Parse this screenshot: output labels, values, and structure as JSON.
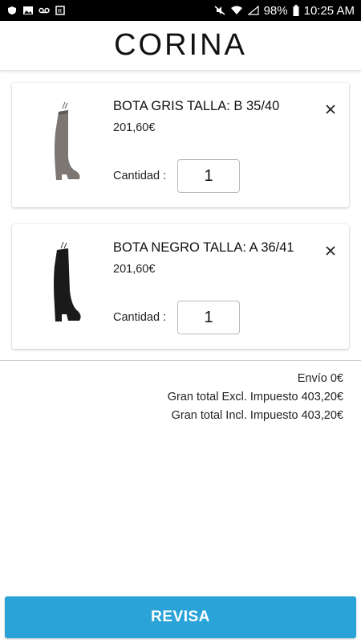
{
  "status_bar": {
    "battery": "98%",
    "time": "10:25 AM",
    "icons": [
      "shield-icon",
      "image-icon",
      "voicemail-icon",
      "data-icon",
      "mute-icon",
      "wifi-icon",
      "signal-icon",
      "battery-icon"
    ]
  },
  "header": {
    "brand": "CORINA"
  },
  "cart": {
    "items": [
      {
        "name": "BOTA GRIS TALLA: B 35/40",
        "price": "201,60€",
        "quantity_label": "Cantidad :",
        "quantity": "1",
        "image": "grey-boot",
        "color": "#7d7774"
      },
      {
        "name": "BOTA NEGRO TALLA: A 36/41",
        "price": "201,60€",
        "quantity_label": "Cantidad :",
        "quantity": "1",
        "image": "black-boot",
        "color": "#1a1a1a"
      }
    ]
  },
  "totals": {
    "shipping": "Envío 0€",
    "excl_tax": "Gran total Excl. Impuesto 403,20€",
    "incl_tax": "Gran total Incl. Impuesto 403,20€"
  },
  "actions": {
    "review": "REVISA"
  },
  "colors": {
    "accent": "#2aa3d8"
  }
}
